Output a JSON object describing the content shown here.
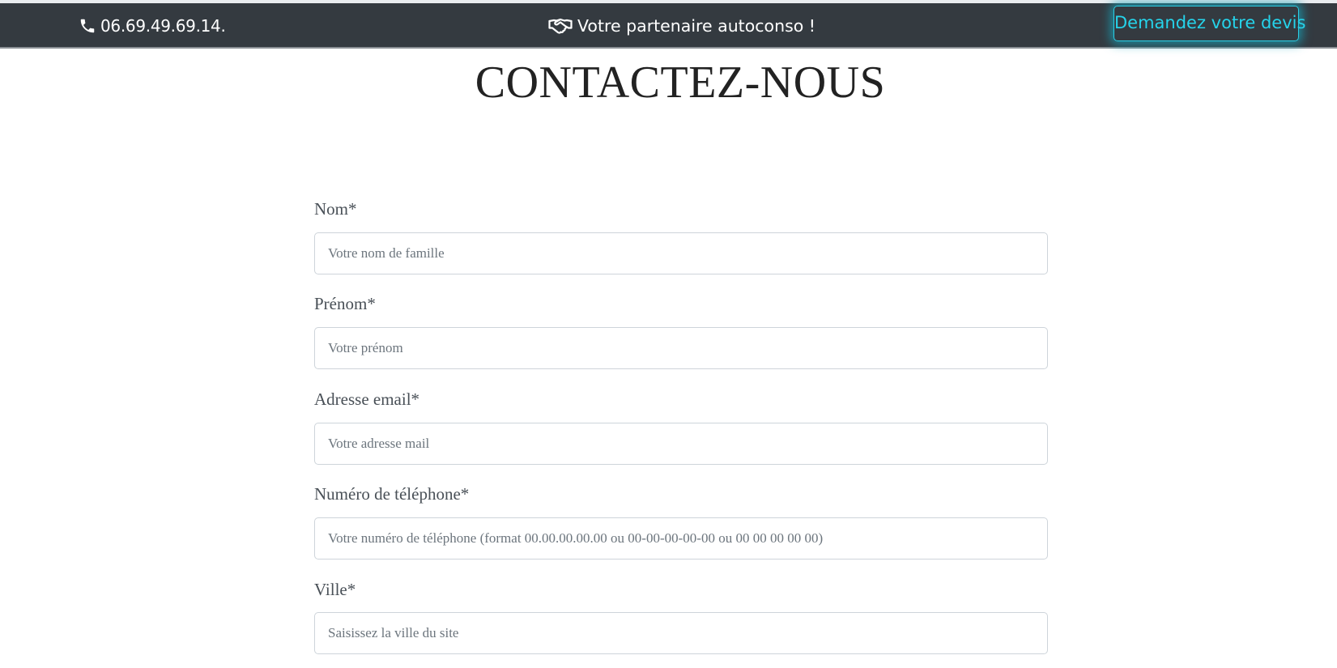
{
  "topbar": {
    "phone": "06.69.49.69.14.",
    "phone_icon": "phone-icon",
    "tagline": "Votre partenaire autoconso !",
    "tagline_icon": "handshake-icon",
    "cta_label": "Demandez votre devis"
  },
  "colors": {
    "topbar_bg": "#343a40",
    "accent": "#17a2b8",
    "label": "#495057",
    "title": "#222222"
  },
  "page": {
    "title": "CONTACTEZ-NOUS"
  },
  "form": {
    "fields": [
      {
        "label": "Nom*",
        "placeholder": "Votre nom de famille"
      },
      {
        "label": "Prénom*",
        "placeholder": "Votre prénom"
      },
      {
        "label": "Adresse email*",
        "placeholder": "Votre adresse mail"
      },
      {
        "label": "Numéro de téléphone*",
        "placeholder": "Votre numéro de téléphone (format 00.00.00.00.00 ou 00-00-00-00-00 ou 00 00 00 00 00)"
      },
      {
        "label": "Ville*",
        "placeholder": "Saisissez la ville du site"
      }
    ]
  }
}
